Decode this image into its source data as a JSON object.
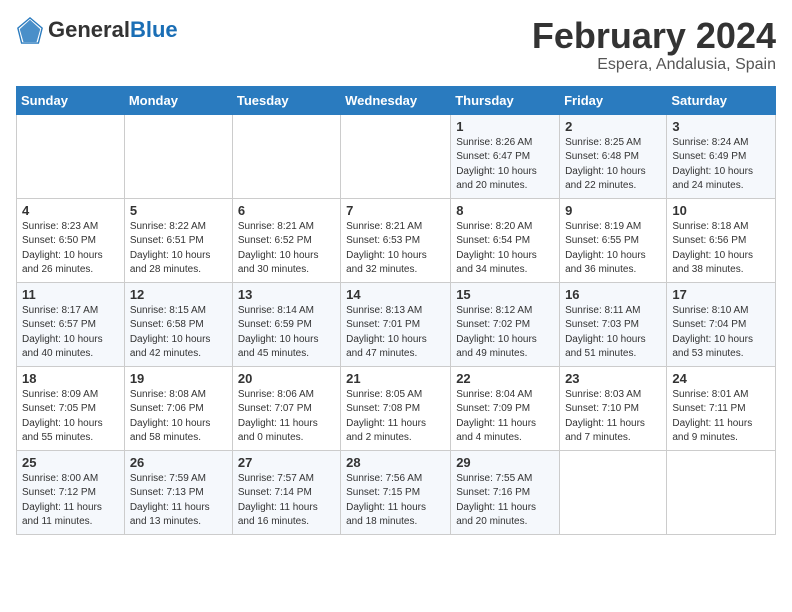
{
  "logo": {
    "general": "General",
    "blue": "Blue"
  },
  "title": {
    "month_year": "February 2024",
    "location": "Espera, Andalusia, Spain"
  },
  "days_of_week": [
    "Sunday",
    "Monday",
    "Tuesday",
    "Wednesday",
    "Thursday",
    "Friday",
    "Saturday"
  ],
  "weeks": [
    [
      {
        "num": "",
        "info": ""
      },
      {
        "num": "",
        "info": ""
      },
      {
        "num": "",
        "info": ""
      },
      {
        "num": "",
        "info": ""
      },
      {
        "num": "1",
        "info": "Sunrise: 8:26 AM\nSunset: 6:47 PM\nDaylight: 10 hours and 20 minutes."
      },
      {
        "num": "2",
        "info": "Sunrise: 8:25 AM\nSunset: 6:48 PM\nDaylight: 10 hours and 22 minutes."
      },
      {
        "num": "3",
        "info": "Sunrise: 8:24 AM\nSunset: 6:49 PM\nDaylight: 10 hours and 24 minutes."
      }
    ],
    [
      {
        "num": "4",
        "info": "Sunrise: 8:23 AM\nSunset: 6:50 PM\nDaylight: 10 hours and 26 minutes."
      },
      {
        "num": "5",
        "info": "Sunrise: 8:22 AM\nSunset: 6:51 PM\nDaylight: 10 hours and 28 minutes."
      },
      {
        "num": "6",
        "info": "Sunrise: 8:21 AM\nSunset: 6:52 PM\nDaylight: 10 hours and 30 minutes."
      },
      {
        "num": "7",
        "info": "Sunrise: 8:21 AM\nSunset: 6:53 PM\nDaylight: 10 hours and 32 minutes."
      },
      {
        "num": "8",
        "info": "Sunrise: 8:20 AM\nSunset: 6:54 PM\nDaylight: 10 hours and 34 minutes."
      },
      {
        "num": "9",
        "info": "Sunrise: 8:19 AM\nSunset: 6:55 PM\nDaylight: 10 hours and 36 minutes."
      },
      {
        "num": "10",
        "info": "Sunrise: 8:18 AM\nSunset: 6:56 PM\nDaylight: 10 hours and 38 minutes."
      }
    ],
    [
      {
        "num": "11",
        "info": "Sunrise: 8:17 AM\nSunset: 6:57 PM\nDaylight: 10 hours and 40 minutes."
      },
      {
        "num": "12",
        "info": "Sunrise: 8:15 AM\nSunset: 6:58 PM\nDaylight: 10 hours and 42 minutes."
      },
      {
        "num": "13",
        "info": "Sunrise: 8:14 AM\nSunset: 6:59 PM\nDaylight: 10 hours and 45 minutes."
      },
      {
        "num": "14",
        "info": "Sunrise: 8:13 AM\nSunset: 7:01 PM\nDaylight: 10 hours and 47 minutes."
      },
      {
        "num": "15",
        "info": "Sunrise: 8:12 AM\nSunset: 7:02 PM\nDaylight: 10 hours and 49 minutes."
      },
      {
        "num": "16",
        "info": "Sunrise: 8:11 AM\nSunset: 7:03 PM\nDaylight: 10 hours and 51 minutes."
      },
      {
        "num": "17",
        "info": "Sunrise: 8:10 AM\nSunset: 7:04 PM\nDaylight: 10 hours and 53 minutes."
      }
    ],
    [
      {
        "num": "18",
        "info": "Sunrise: 8:09 AM\nSunset: 7:05 PM\nDaylight: 10 hours and 55 minutes."
      },
      {
        "num": "19",
        "info": "Sunrise: 8:08 AM\nSunset: 7:06 PM\nDaylight: 10 hours and 58 minutes."
      },
      {
        "num": "20",
        "info": "Sunrise: 8:06 AM\nSunset: 7:07 PM\nDaylight: 11 hours and 0 minutes."
      },
      {
        "num": "21",
        "info": "Sunrise: 8:05 AM\nSunset: 7:08 PM\nDaylight: 11 hours and 2 minutes."
      },
      {
        "num": "22",
        "info": "Sunrise: 8:04 AM\nSunset: 7:09 PM\nDaylight: 11 hours and 4 minutes."
      },
      {
        "num": "23",
        "info": "Sunrise: 8:03 AM\nSunset: 7:10 PM\nDaylight: 11 hours and 7 minutes."
      },
      {
        "num": "24",
        "info": "Sunrise: 8:01 AM\nSunset: 7:11 PM\nDaylight: 11 hours and 9 minutes."
      }
    ],
    [
      {
        "num": "25",
        "info": "Sunrise: 8:00 AM\nSunset: 7:12 PM\nDaylight: 11 hours and 11 minutes."
      },
      {
        "num": "26",
        "info": "Sunrise: 7:59 AM\nSunset: 7:13 PM\nDaylight: 11 hours and 13 minutes."
      },
      {
        "num": "27",
        "info": "Sunrise: 7:57 AM\nSunset: 7:14 PM\nDaylight: 11 hours and 16 minutes."
      },
      {
        "num": "28",
        "info": "Sunrise: 7:56 AM\nSunset: 7:15 PM\nDaylight: 11 hours and 18 minutes."
      },
      {
        "num": "29",
        "info": "Sunrise: 7:55 AM\nSunset: 7:16 PM\nDaylight: 11 hours and 20 minutes."
      },
      {
        "num": "",
        "info": ""
      },
      {
        "num": "",
        "info": ""
      }
    ]
  ]
}
